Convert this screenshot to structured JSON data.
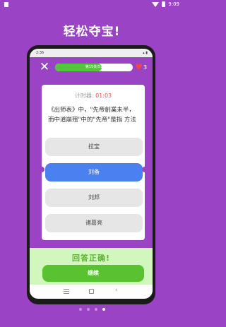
{
  "os_status": {
    "time": "9:09"
  },
  "promo_title": "轻松夺宝!",
  "inner_status": {
    "time": "2:36"
  },
  "progress": {
    "label": "第15关/51",
    "fraction": 0.6,
    "fill_color": "#53c73c"
  },
  "lives": "3",
  "timer": {
    "label": "计时器:",
    "value": "01:03"
  },
  "question": "《出师表》中，\"先帝創業未半，而中道崩殂\"中的\"先帝\"是指 方法",
  "options": [
    "拉宝",
    "刘备",
    "刘邦",
    "诸葛亮"
  ],
  "selected_option_index": 1,
  "feedback": "回答正确!",
  "continue_label": "继续",
  "colors": {
    "background": "#9a43c4",
    "selected": "#4b80f0",
    "correct": "#58b628",
    "heart": "#f04545"
  },
  "page_indicator": {
    "count": 4,
    "active_index": 3
  }
}
